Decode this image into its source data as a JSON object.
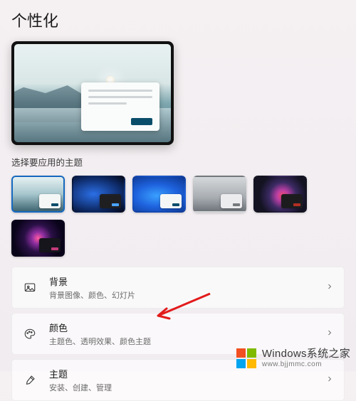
{
  "page_title": "个性化",
  "section_label": "选择要应用的主题",
  "themes": [
    {
      "name": "windows-light",
      "selected": true
    },
    {
      "name": "windows-bloom-dark",
      "selected": false
    },
    {
      "name": "windows-bloom-blue",
      "selected": false
    },
    {
      "name": "grey-gradient",
      "selected": false
    },
    {
      "name": "abstract-flower",
      "selected": false
    },
    {
      "name": "purple-orb",
      "selected": false
    }
  ],
  "rows": {
    "background": {
      "title": "背景",
      "sub": "背景图像、颜色、幻灯片"
    },
    "colors": {
      "title": "颜色",
      "sub": "主题色、透明效果、颜色主题"
    },
    "themes_row": {
      "title": "主题",
      "sub": "安装、创建、管理"
    }
  },
  "watermark": {
    "brand": "Windows系统之家",
    "url": "www.bjjmmc.com"
  }
}
